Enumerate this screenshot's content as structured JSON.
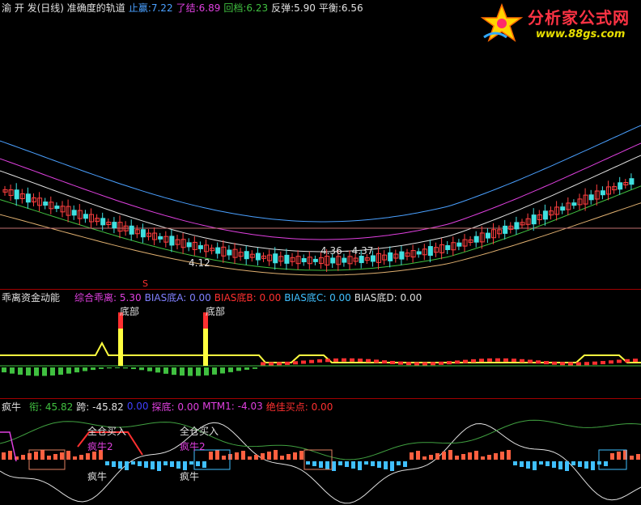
{
  "colors": {
    "background": "#000000",
    "divider": "#a00000"
  },
  "header": {
    "title": "渝 开 发(日线) 准确度的轨道",
    "items": [
      {
        "label": "止赢:",
        "value": "7.22",
        "color": "#4aa0ff"
      },
      {
        "label": "了结:",
        "value": "6.89",
        "color": "#e040e0"
      },
      {
        "label": "回档:",
        "value": "6.23",
        "color": "#40c040"
      },
      {
        "label": "反弹:",
        "value": "5.90",
        "color": "#e0e0e0"
      },
      {
        "label": "平衡:",
        "value": "6.56",
        "color": "#e0e0e0"
      }
    ]
  },
  "logo": {
    "title": "分析家公式网",
    "url": "www.88gs.com"
  },
  "main_chart": {
    "annotations": {
      "low_a": "4.12",
      "range_b": "4.36 - 4.37",
      "marker_s": "S"
    }
  },
  "indicator1": {
    "title": "乖离资金动能",
    "items": [
      {
        "label": "综合乖离:",
        "value": "5.30",
        "color": "#e040e0"
      },
      {
        "label": "BIAS底A:",
        "value": "0.00",
        "color": "#8080ff"
      },
      {
        "label": "BIAS底B:",
        "value": "0.00",
        "color": "#ff3030"
      },
      {
        "label": "BIAS底C:",
        "value": "0.00",
        "color": "#40c0ff"
      },
      {
        "label": "BIAS底D:",
        "value": "0.00",
        "color": "#e0e0e0"
      }
    ],
    "bottom_label_1": "底部",
    "bottom_label_2": "底部"
  },
  "indicator2": {
    "title": "疯牛",
    "items": [
      {
        "label": "衔:",
        "value": "45.82",
        "color": "#40c040"
      },
      {
        "label": "跨:",
        "value": "-45.82",
        "color": "#e0e0e0"
      },
      {
        "label": "",
        "value": "0.00",
        "color": "#4040ff"
      },
      {
        "label": "探底:",
        "value": "0.00",
        "color": "#e040e0"
      },
      {
        "label": "MTM1:",
        "value": "-4.03",
        "color": "#e040e0"
      },
      {
        "label": "绝佳买点:",
        "value": "0.00",
        "color": "#ff3030"
      }
    ],
    "buy_label_1": "全仓买入",
    "buy_label_2": "全仓买入",
    "bull_label_1": "疯牛2",
    "bull_label_2": "疯牛2",
    "bull_bottom_1": "疯牛",
    "bull_bottom_2": "疯牛"
  }
}
